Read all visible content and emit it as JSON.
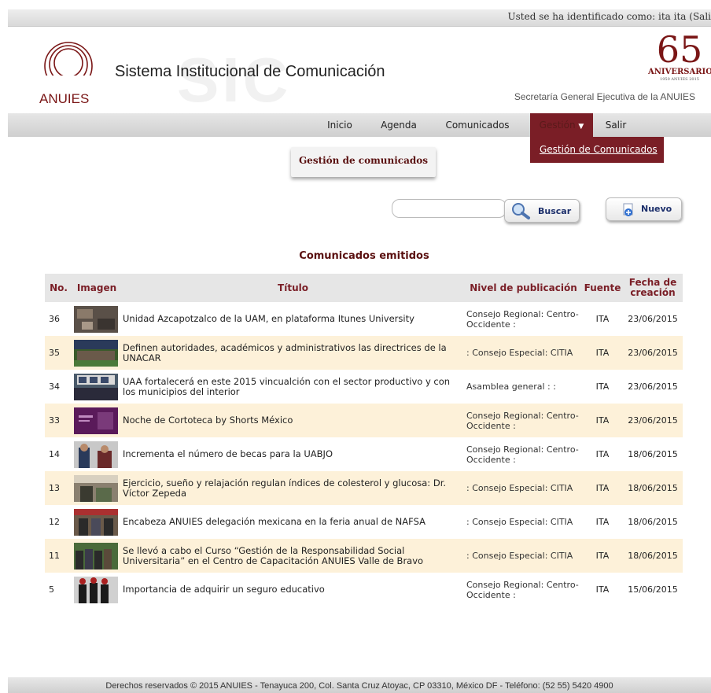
{
  "topbar": {
    "user_text": "Usted se ha identificado como: ita ita (Sali"
  },
  "header": {
    "logo_text": "ANUIES",
    "watermark": "SIC",
    "title": "Sistema Institucional de Comunicación",
    "anniv_number": "65",
    "anniv_word": "ANIVERSARIO",
    "anniv_years": "1950 ANUIES 2015",
    "subtitle": "Secretaría General Ejecutiva de la ANUIES"
  },
  "nav": {
    "items": [
      {
        "label": "Inicio"
      },
      {
        "label": "Agenda"
      },
      {
        "label": "Comunicados"
      },
      {
        "label": "Gestión"
      },
      {
        "label": "Salir"
      }
    ],
    "dropdown_item": "Gestión de Comunicados"
  },
  "page": {
    "card_title": "Gestión de comunicados",
    "search_placeholder": "",
    "search_button": "Buscar",
    "new_button": "Nuevo",
    "list_heading": "Comunicados emitidos"
  },
  "table": {
    "headers": [
      "No.",
      "Imagen",
      "Título",
      "Nivel de publicación",
      "Fuente",
      "Fecha de creación"
    ],
    "rows": [
      {
        "no": "36",
        "title": "Unidad Azcapotzalco de la UAM, en plataforma Itunes University",
        "nivel": "Consejo Regional: Centro-Occidente :",
        "fuente": "ITA",
        "fecha": "23/06/2015"
      },
      {
        "no": "35",
        "title": "Definen autoridades, académicos y administrativos las directrices de la UNACAR",
        "nivel": ": Consejo Especial: CITIA",
        "fuente": "ITA",
        "fecha": "23/06/2015"
      },
      {
        "no": "34",
        "title": "UAA fortalecerá en este 2015 vincualción con el sector productivo y con los municipios del interior",
        "nivel": "Asamblea general : :",
        "fuente": "ITA",
        "fecha": "23/06/2015"
      },
      {
        "no": "33",
        "title": "Noche de Cortoteca by Shorts México",
        "nivel": "Consejo Regional: Centro-Occidente :",
        "fuente": "ITA",
        "fecha": "23/06/2015"
      },
      {
        "no": "14",
        "title": "Incrementa el número de becas para la UABJO",
        "nivel": "Consejo Regional: Centro-Occidente :",
        "fuente": "ITA",
        "fecha": "18/06/2015"
      },
      {
        "no": "13",
        "title": "Ejercicio, sueño y relajación regulan índices de colesterol y glucosa: Dr. Víctor Zepeda",
        "nivel": ": Consejo Especial: CITIA",
        "fuente": "ITA",
        "fecha": "18/06/2015"
      },
      {
        "no": "12",
        "title": "Encabeza ANUIES delegación mexicana en la feria anual de NAFSA",
        "nivel": ": Consejo Especial: CITIA",
        "fuente": "ITA",
        "fecha": "18/06/2015"
      },
      {
        "no": "11",
        "title": "Se llevó a cabo el Curso “Gestión de la Responsabilidad Social Universitaria” en el Centro de Capacitación ANUIES Valle de Bravo",
        "nivel": ": Consejo Especial: CITIA",
        "fuente": "ITA",
        "fecha": "18/06/2015"
      },
      {
        "no": "5",
        "title": "Importancia de adquirir un seguro educativo",
        "nivel": "Consejo Regional: Centro-Occidente :",
        "fuente": "ITA",
        "fecha": "15/06/2015"
      }
    ]
  },
  "footer": {
    "text": "Derechos reservados © 2015 ANUIES - Tenayuca 200, Col. Santa Cruz Atoyac, CP 03310, México DF - Teléfono: (52 55) 5420 4900"
  },
  "colors": {
    "brand": "#7a1e26",
    "row_alt": "#fdf1d9",
    "header_bg": "#e6e6e6"
  }
}
